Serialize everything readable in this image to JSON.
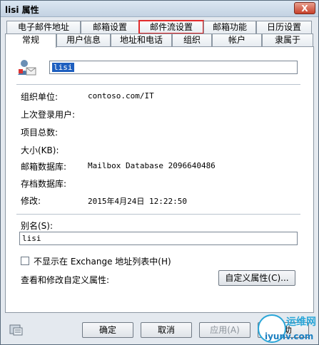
{
  "window": {
    "title": "lisi 属性",
    "close_label": "X"
  },
  "tabs": {
    "row1": [
      "电子邮件地址",
      "邮箱设置",
      "邮件流设置",
      "邮箱功能",
      "日历设置"
    ],
    "row2": [
      "常规",
      "用户信息",
      "地址和电话",
      "组织",
      "帐户",
      "隶属于"
    ],
    "active": "常规",
    "highlighted": "邮件流设置"
  },
  "general": {
    "display_name": "lisi",
    "fields": [
      {
        "label": "组织单位:",
        "value": "contoso.com/IT"
      },
      {
        "label": "上次登录用户:",
        "value": ""
      },
      {
        "label": "项目总数:",
        "value": ""
      },
      {
        "label": "大小(KB):",
        "value": ""
      },
      {
        "label": "邮箱数据库:",
        "value": "Mailbox Database 2096640486"
      },
      {
        "label": "存档数据库:",
        "value": ""
      },
      {
        "label": "修改:",
        "value": "2015年4月24日 12:22:50"
      }
    ],
    "alias_label": "别名(S):",
    "alias_value": "lisi",
    "hide_checkbox_label": "不显示在 Exchange 地址列表中(H)",
    "hide_checked": false,
    "custom_attr_label": "查看和修改自定义属性:",
    "custom_attr_button": "自定义属性(C)..."
  },
  "footer": {
    "ok": "确定",
    "cancel": "取消",
    "apply": "应用(A)",
    "help": "帮助"
  },
  "watermark": {
    "line1": "运维网",
    "line2": "iyunv.com"
  },
  "icons": {
    "user": "user-mailbox-icon",
    "footer": "properties-icon"
  },
  "colors": {
    "highlight_border": "#e12b2b",
    "selection": "#1e5fbf"
  }
}
